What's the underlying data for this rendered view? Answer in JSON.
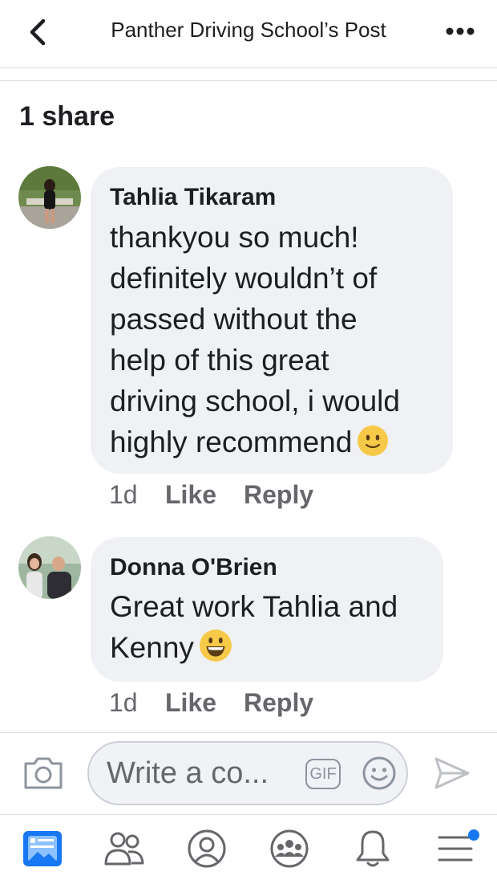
{
  "header": {
    "title": "Panther Driving School’s Post",
    "back_icon": "chevron-left-icon",
    "more_icon": "more-horizontal-icon"
  },
  "shares": "1 share",
  "comments": [
    {
      "author": "Tahlia Tikaram",
      "lines": [
        "thankyou so much!",
        "definitely wouldn’t of",
        "passed without the",
        "help of this great",
        "driving school, i would",
        "highly recommend"
      ],
      "emoji": "slightly-smiling-face-emoji",
      "time": "1d",
      "like_label": "Like",
      "reply_label": "Reply"
    },
    {
      "author": "Donna O'Brien",
      "lines": [
        "Great work Tahlia and",
        "Kenny"
      ],
      "emoji": "grinning-face-emoji",
      "time": "1d",
      "like_label": "Like",
      "reply_label": "Reply"
    }
  ],
  "composer": {
    "placeholder": "Write a co...",
    "gif_label": "GIF",
    "camera_icon": "camera-icon",
    "emoji_icon": "smiley-icon",
    "send_icon": "send-icon"
  },
  "tabbar": {
    "items": [
      "news-feed-icon",
      "friends-icon",
      "profile-icon",
      "groups-icon",
      "notifications-icon",
      "menu-icon"
    ],
    "menu_badge": true
  },
  "colors": {
    "bubble": "#f0f1f4",
    "accent": "#1877f2",
    "meta_text": "#65676b",
    "emoji_yellow": "#f7c948"
  }
}
